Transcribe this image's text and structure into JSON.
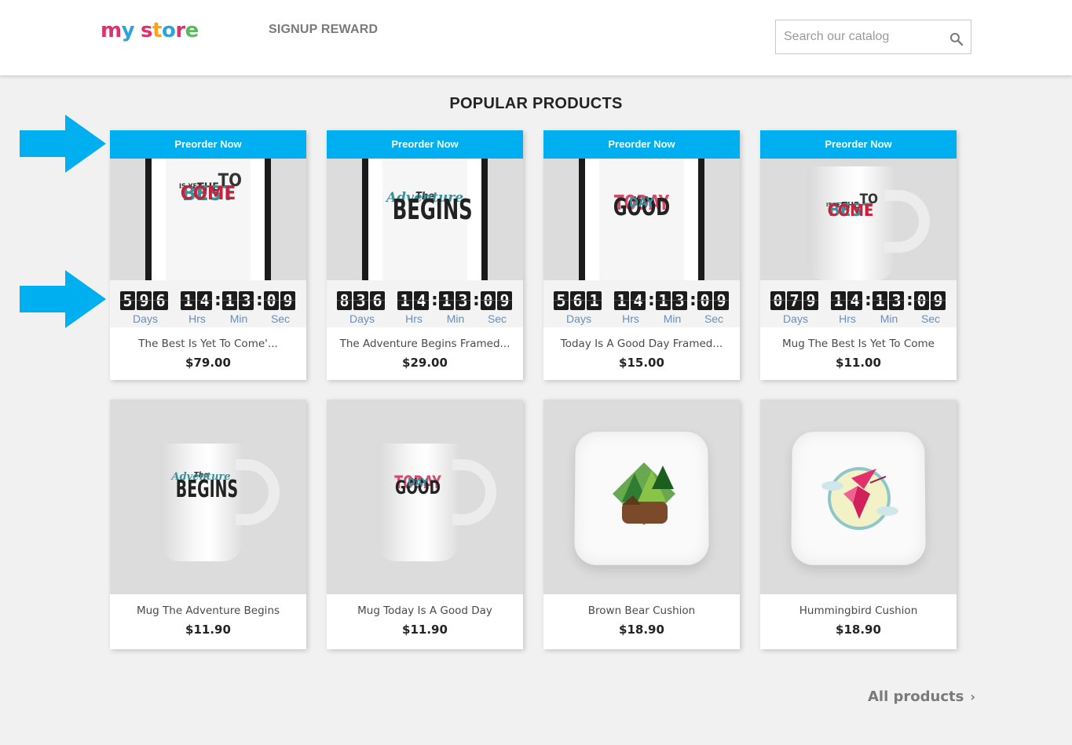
{
  "header": {
    "logo_letters": [
      "m",
      "y",
      " ",
      "s",
      "t",
      "o",
      "r",
      "e"
    ],
    "logo_colors": [
      "#e2306c",
      "#2ba3db",
      "#fff",
      "#e2306c",
      "#f7a31b",
      "#2ba3db",
      "#e2306c",
      "#5bb85c"
    ],
    "nav_link": "SIGNUP REWARD",
    "search_placeholder": "Search our catalog",
    "search_icon": "search-icon"
  },
  "section_title": "POPULAR PRODUCTS",
  "accent_color": "#00aff0",
  "countdown_labels": {
    "days": "Days",
    "hrs": "Hrs",
    "min": "Min",
    "sec": "Sec"
  },
  "products_row1": [
    {
      "badge": "Preorder Now",
      "name": "The Best Is Yet To Come'...",
      "price": "$79.00",
      "days": [
        "5",
        "9",
        "6"
      ],
      "hrs": [
        "1",
        "4"
      ],
      "min": [
        "1",
        "3"
      ],
      "sec": [
        "0",
        "9"
      ]
    },
    {
      "badge": "Preorder Now",
      "name": "The Adventure Begins Framed...",
      "price": "$29.00",
      "days": [
        "8",
        "3",
        "6"
      ],
      "hrs": [
        "1",
        "4"
      ],
      "min": [
        "1",
        "3"
      ],
      "sec": [
        "0",
        "9"
      ]
    },
    {
      "badge": "Preorder Now",
      "name": "Today Is A Good Day Framed...",
      "price": "$15.00",
      "days": [
        "5",
        "6",
        "1"
      ],
      "hrs": [
        "1",
        "4"
      ],
      "min": [
        "1",
        "3"
      ],
      "sec": [
        "0",
        "9"
      ]
    },
    {
      "badge": "Preorder Now",
      "name": "Mug The Best Is Yet To Come",
      "price": "$11.00",
      "days": [
        "0",
        "7",
        "9"
      ],
      "hrs": [
        "1",
        "4"
      ],
      "min": [
        "1",
        "3"
      ],
      "sec": [
        "0",
        "9"
      ]
    }
  ],
  "products_row2": [
    {
      "name": "Mug The Adventure Begins",
      "price": "$11.90"
    },
    {
      "name": "Mug Today Is A Good Day",
      "price": "$11.90"
    },
    {
      "name": "Brown Bear Cushion",
      "price": "$18.90"
    },
    {
      "name": "Hummingbird Cushion",
      "price": "$18.90"
    }
  ],
  "art": {
    "best1": "THE",
    "best2": "BEST",
    "best3": "IS YET",
    "best4": "TO",
    "best5": "COME",
    "adv1": "The",
    "adv2": "Adventure",
    "adv3": "BEGINS",
    "today1": "TODAY",
    "today2": "IS A",
    "today3": "GOOD",
    "today4": "DAY"
  },
  "all_products": "All products",
  "all_products_icon": "chevron-right-icon"
}
